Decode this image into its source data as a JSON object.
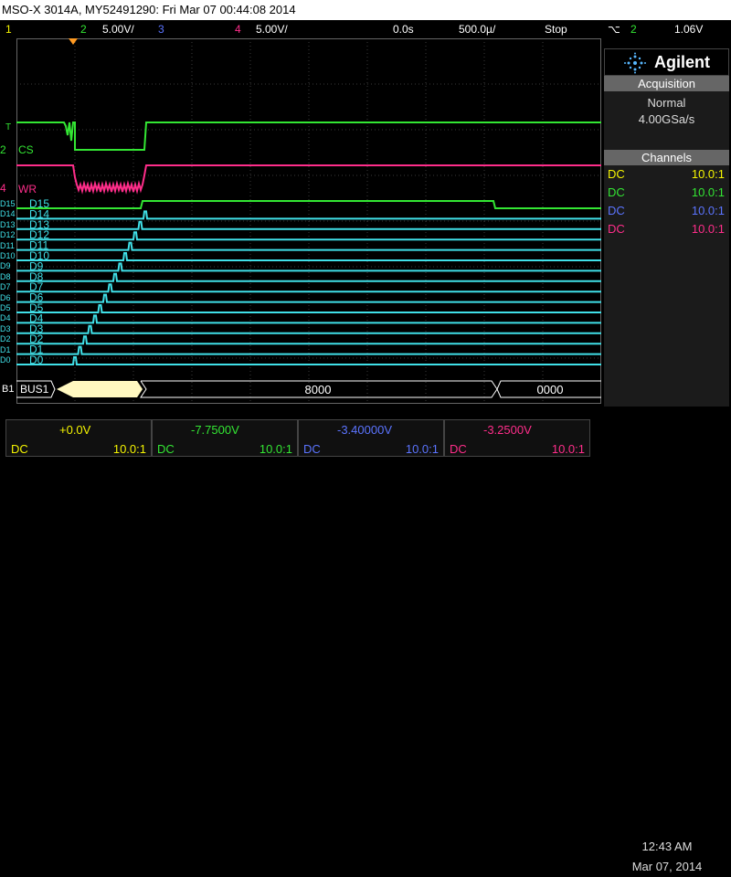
{
  "window": {
    "title": "MSO-X 3014A, MY52491290: Fri Mar 07 00:44:08 2014"
  },
  "channels_bar": {
    "ch1_num": "1",
    "ch2_num": "2",
    "ch2_scale": "5.00V/",
    "ch3_num": "3",
    "ch4_num": "4",
    "ch4_scale": "5.00V/",
    "delay": "0.0s",
    "timebase": "500.0µ/",
    "run_state": "Stop",
    "trig_channel": "2",
    "trig_level": "1.06V"
  },
  "brand": {
    "name": "Agilent"
  },
  "acquisition": {
    "header": "Acquisition",
    "mode": "Normal",
    "rate": "4.00GSa/s"
  },
  "channels_panel": {
    "header": "Channels",
    "rows": [
      {
        "coupling": "DC",
        "ratio": "10.0:1",
        "color": "#f5f500"
      },
      {
        "coupling": "DC",
        "ratio": "10.0:1",
        "color": "#33e633"
      },
      {
        "coupling": "DC",
        "ratio": "10.0:1",
        "color": "#5b74ff"
      },
      {
        "coupling": "DC",
        "ratio": "10.0:1",
        "color": "#ff2d8a"
      }
    ]
  },
  "waveform": {
    "cs_label": "CS",
    "wr_label": "WR",
    "ch2_marker": "2",
    "ch4_marker": "4",
    "trigger_marker": "T",
    "digital_labels": [
      "D15",
      "D14",
      "D13",
      "D12",
      "D11",
      "D10",
      "D9",
      "D8",
      "D7",
      "D6",
      "D5",
      "D4",
      "D3",
      "D2",
      "D1",
      "D0"
    ],
    "digital_markers": [
      "D15",
      "D14",
      "D13",
      "D12",
      "D11",
      "D10",
      "D9",
      "D8",
      "D7",
      "D6",
      "D5",
      "D4",
      "D3",
      "D2",
      "D1",
      "D0"
    ],
    "bus_marker": "B1",
    "bus_label": "BUS1",
    "bus_values": [
      "8000",
      "0000"
    ]
  },
  "bottom_bar": {
    "channels": [
      {
        "offset": "+0.0V",
        "coupling": "DC",
        "ratio": "10.0:1",
        "color": "#f5f500"
      },
      {
        "offset": "-7.7500V",
        "coupling": "DC",
        "ratio": "10.0:1",
        "color": "#33e633"
      },
      {
        "offset": "-3.40000V",
        "coupling": "DC",
        "ratio": "10.0:1",
        "color": "#5b74ff"
      },
      {
        "offset": "-3.2500V",
        "coupling": "DC",
        "ratio": "10.0:1",
        "color": "#ff2d8a"
      }
    ],
    "time": "12:43 AM",
    "date": "Mar 07, 2014"
  },
  "colors": {
    "ch1": "#f5f500",
    "ch2": "#33e633",
    "ch3": "#5b74ff",
    "ch4": "#ff2d8a",
    "digital": "#40e0e8",
    "trigger": "#ff9a22",
    "grid": "#3a3a3a"
  }
}
